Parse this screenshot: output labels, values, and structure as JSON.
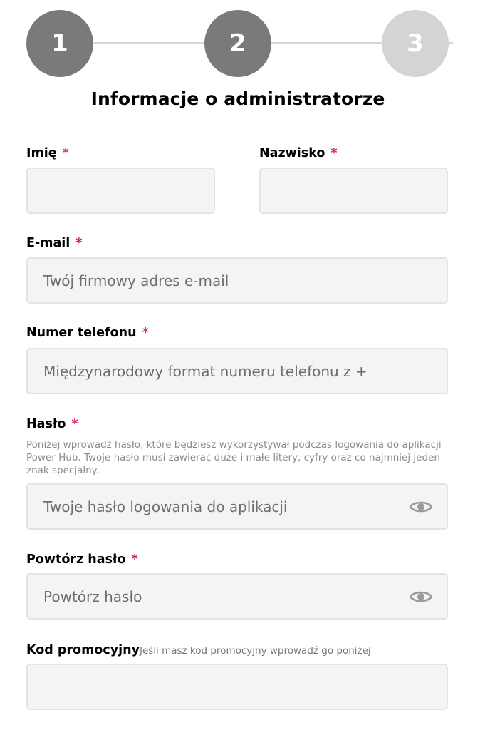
{
  "stepper": {
    "steps": [
      {
        "number": "1",
        "state": "completed"
      },
      {
        "number": "2",
        "state": "active"
      },
      {
        "number": "3",
        "state": "inactive"
      }
    ],
    "colors": {
      "active": "#7a7a7a",
      "inactive": "#d4d4d4",
      "line": "#d6d6d6"
    }
  },
  "title": "Informacje o administratorze",
  "required_marker": "*",
  "required_color": "#d81f4a",
  "fields": {
    "first_name": {
      "label": "Imię",
      "value": "",
      "placeholder": ""
    },
    "last_name": {
      "label": "Nazwisko",
      "value": "",
      "placeholder": ""
    },
    "email": {
      "label": "E-mail",
      "value": "",
      "placeholder": "Twój firmowy adres e-mail"
    },
    "phone": {
      "label": "Numer telefonu",
      "value": "",
      "placeholder": "Międzynarodowy format numeru telefonu z +"
    },
    "password": {
      "label": "Hasło",
      "help": "Poniżej wprowadź hasło, które będziesz wykorzystywał podczas logowania do aplikacji Power Hub. Twoje hasło musi zawierać duże i małe litery, cyfry oraz co najmniej jeden znak specjalny.",
      "value": "",
      "placeholder": "Twoje hasło logowania do aplikacji",
      "icon": "eye-icon"
    },
    "password_repeat": {
      "label": "Powtórz hasło",
      "value": "",
      "placeholder": "Powtórz hasło",
      "icon": "eye-icon"
    },
    "promo_code": {
      "label": "Kod promocyjny",
      "hint": "Jeśli masz kod promocyjny wprowadź go poniżej",
      "value": "",
      "placeholder": ""
    }
  }
}
